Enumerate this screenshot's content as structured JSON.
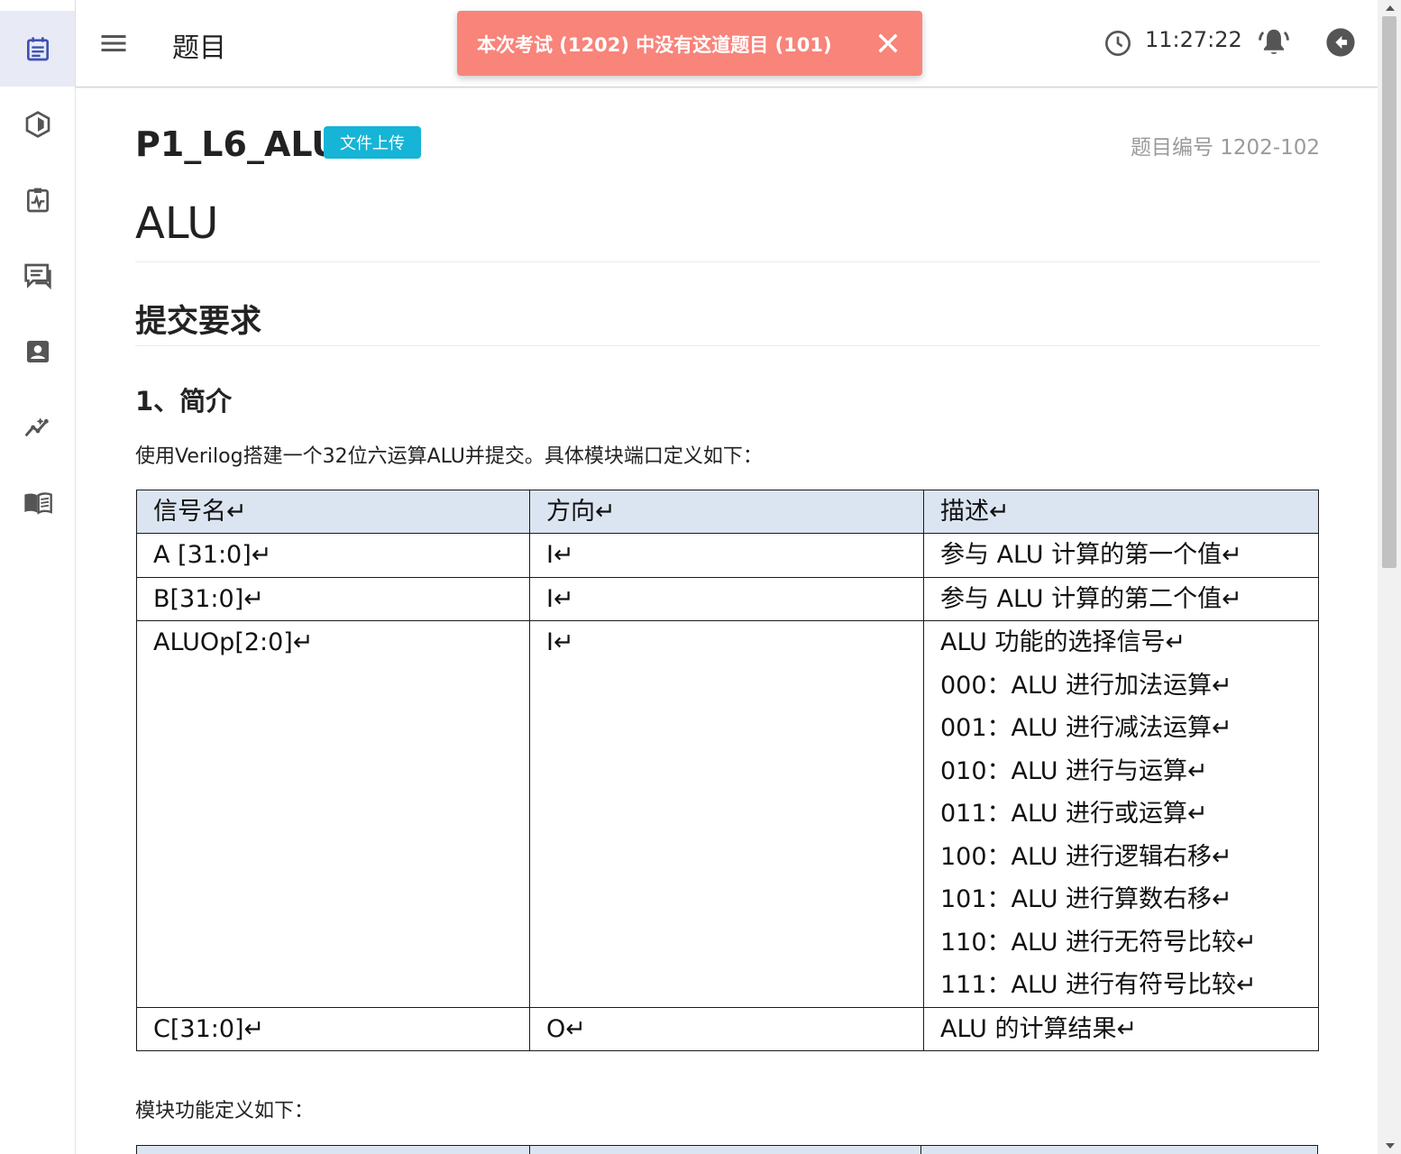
{
  "appbar": {
    "title": "题目",
    "clock": "11:27:22"
  },
  "toast": {
    "message": "本次考试 (1202) 中没有这道题目 (101)"
  },
  "sidebar": {
    "items": [
      "assignment-icon",
      "cube-icon",
      "clipboard-pulse-icon",
      "forum-icon",
      "contact-card-icon",
      "analytics-icon",
      "book-open-icon"
    ]
  },
  "problem": {
    "title": "P1_L6_ALU",
    "badge": "文件上传",
    "id_label": "题目编号 1202-102",
    "h1": "ALU",
    "h2": "提交要求",
    "h3": "1、简介",
    "intro": "使用Verilog搭建一个32位六运算ALU并提交。具体模块端口定义如下：",
    "after_table": "模块功能定义如下："
  },
  "signal_table": {
    "headers": [
      "信号名↵",
      "方向↵",
      "描述↵"
    ],
    "rows": [
      {
        "name": "A [31:0]↵",
        "dir": "I↵",
        "desc": [
          "参与 ALU 计算的第一个值↵"
        ]
      },
      {
        "name": "B[31:0]↵",
        "dir": "I↵",
        "desc": [
          "参与 ALU 计算的第二个值↵"
        ]
      },
      {
        "name": "ALUOp[2:0]↵",
        "dir": "I↵",
        "desc": [
          "ALU 功能的选择信号↵",
          "000：ALU 进行加法运算↵",
          "001：ALU 进行减法运算↵",
          "010：ALU 进行与运算↵",
          "011：ALU 进行或运算↵",
          "100：ALU 进行逻辑右移↵",
          "101：ALU 进行算数右移↵",
          "110：ALU 进行无符号比较↵",
          "111：ALU 进行有符号比较↵"
        ]
      },
      {
        "name": "C[31:0]↵",
        "dir": "O↵",
        "desc": [
          "ALU 的计算结果↵"
        ]
      }
    ]
  },
  "colors": {
    "toast_bg": "#f8847a",
    "badge_bg": "#16b4d6",
    "sidebar_active_bg": "#e8eaf6",
    "table_header_bg": "#dbe5f1",
    "icon_blue": "#3f51b5",
    "icon_gray": "#555555"
  }
}
